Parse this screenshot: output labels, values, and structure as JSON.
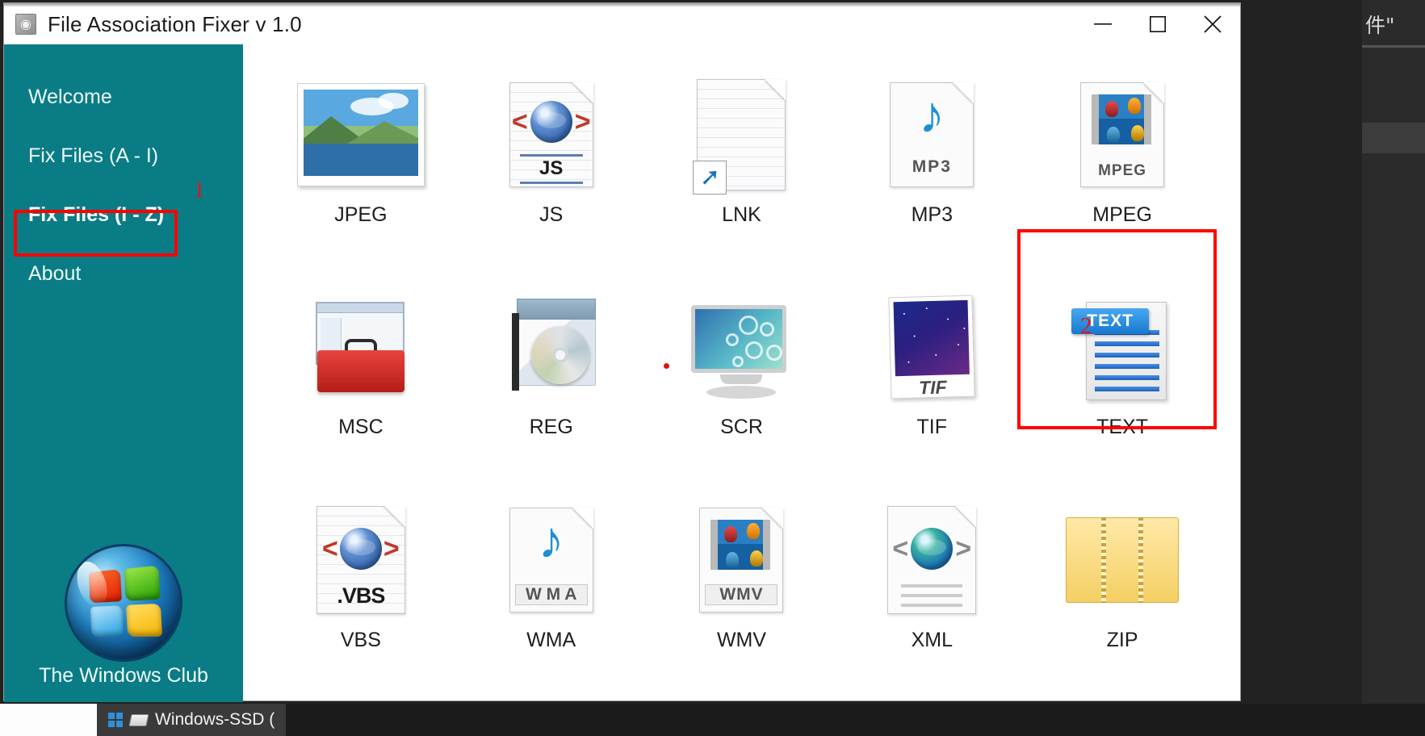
{
  "window": {
    "title": "File Association Fixer v 1.0",
    "app_icon": "app-logo-icon",
    "minimize_label": "─",
    "maximize_label": "□",
    "close_label": "✕"
  },
  "sidebar": {
    "accent_color": "#0a7c85",
    "items": [
      {
        "label": "Welcome",
        "active": false
      },
      {
        "label": "Fix Files (A - I)",
        "active": false
      },
      {
        "label": "Fix Files (I - Z)",
        "active": true
      },
      {
        "label": "About",
        "active": false
      }
    ],
    "brand": {
      "logo": "windows-orb-icon",
      "text": "The Windows Club"
    }
  },
  "annotations": {
    "color": "#ff0000",
    "marker_1": "1",
    "marker_2": "2"
  },
  "content": {
    "tiles": [
      {
        "label": "JPEG",
        "icon": "jpeg-photo-icon"
      },
      {
        "label": "JS",
        "icon": "js-script-icon",
        "badge": "JS"
      },
      {
        "label": "LNK",
        "icon": "lnk-shortcut-icon"
      },
      {
        "label": "MP3",
        "icon": "mp3-audio-icon",
        "badge": "MP3"
      },
      {
        "label": "MPEG",
        "icon": "mpeg-video-icon",
        "badge": "MPEG"
      },
      {
        "label": "MSC",
        "icon": "msc-console-icon"
      },
      {
        "label": "REG",
        "icon": "reg-registry-icon"
      },
      {
        "label": "SCR",
        "icon": "scr-screensaver-icon"
      },
      {
        "label": "TIF",
        "icon": "tif-image-icon",
        "badge": "TIF"
      },
      {
        "label": "TEXT",
        "icon": "text-document-icon",
        "badge": "TEXT"
      },
      {
        "label": "VBS",
        "icon": "vbs-script-icon",
        "badge": ".VBS"
      },
      {
        "label": "WMA",
        "icon": "wma-audio-icon",
        "badge": "W M A"
      },
      {
        "label": "WMV",
        "icon": "wmv-video-icon",
        "badge": "WMV"
      },
      {
        "label": "XML",
        "icon": "xml-document-icon"
      },
      {
        "label": "ZIP",
        "icon": "zip-archive-icon"
      }
    ]
  },
  "taskbar": {
    "items": [
      {
        "label": "Windows-SSD (",
        "icon": "drive-icon",
        "selected": true
      }
    ]
  },
  "background_panel": {
    "title": "件\""
  }
}
